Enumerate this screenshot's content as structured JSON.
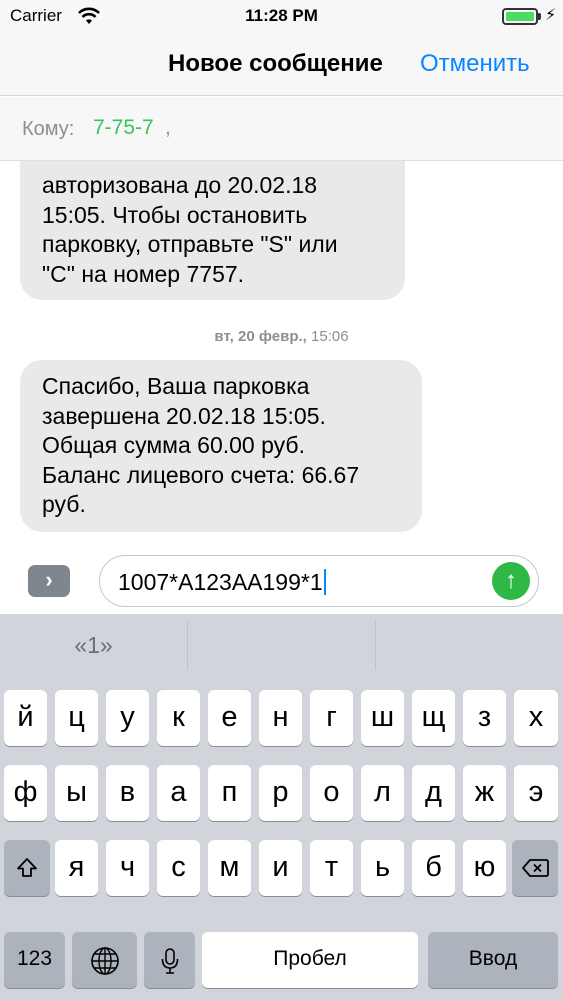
{
  "status_bar": {
    "carrier": "Carrier",
    "time": "11:28 PM"
  },
  "nav": {
    "title": "Новое сообщение",
    "cancel": "Отменить"
  },
  "recipient": {
    "label": "Кому:",
    "value": "7-75-7",
    "separator": ","
  },
  "messages": [
    {
      "text": "авторизована до 20.02.18\n15:05. Чтобы остановить\nпарковку, отправьте \"S\" или\n\"C\" на номер 7757."
    },
    {
      "text": "Спасибо, Ваша парковка\nзавершена 20.02.18 15:05.\nОбщая сумма 60.00 руб.\nБаланс лицевого счета: 66.67\nруб."
    }
  ],
  "timestamp": {
    "date": "вт, 20 февр.,",
    "time": "15:06"
  },
  "composer": {
    "text": "1007*A123AA199*1"
  },
  "keyboard": {
    "predictions": [
      "«1»",
      "",
      ""
    ],
    "row1": [
      "й",
      "ц",
      "у",
      "к",
      "е",
      "н",
      "г",
      "ш",
      "щ",
      "з",
      "х"
    ],
    "row2": [
      "ф",
      "ы",
      "в",
      "а",
      "п",
      "р",
      "о",
      "л",
      "д",
      "ж",
      "э"
    ],
    "row3": [
      "я",
      "ч",
      "с",
      "м",
      "и",
      "т",
      "ь",
      "б",
      "ю"
    ],
    "numbers": "123",
    "space": "Пробел",
    "return": "Ввод"
  },
  "colors": {
    "accent": "#0a84ff",
    "recipient": "#34c759",
    "send": "#2fb845",
    "bubble": "#e9e9eb"
  }
}
